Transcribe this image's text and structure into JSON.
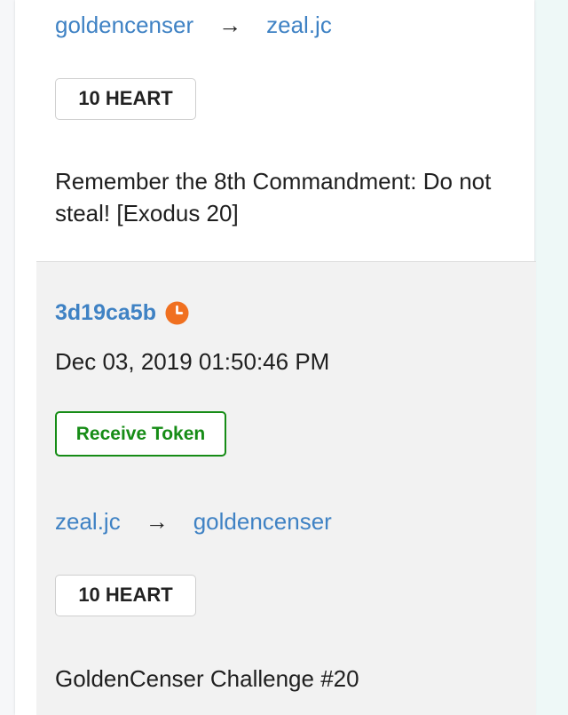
{
  "transactions": [
    {
      "from": "goldencenser",
      "arrow": "→",
      "to": "zeal.jc",
      "amount": "10 HEART",
      "memo": "Remember the 8th Commandment: Do not steal! [Exodus 20]"
    },
    {
      "txid": "3d19ca5b",
      "status_icon": "clock-icon",
      "status_color": "#f07020",
      "timestamp": "Dec 03, 2019 01:50:46 PM",
      "type_label": "Receive Token",
      "type_color": "#168c16",
      "from": "zeal.jc",
      "arrow": "→",
      "to": "goldencenser",
      "amount": "10 HEART",
      "memo": "GoldenCenser Challenge #20"
    }
  ],
  "colors": {
    "link": "#3f82c4",
    "card_bg": "#ffffff",
    "highlight_bg": "#f2f2f2"
  }
}
